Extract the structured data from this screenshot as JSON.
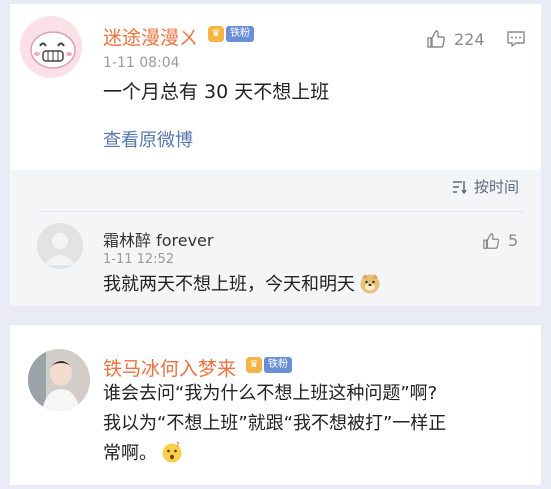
{
  "post": {
    "author": "迷途漫漫ㄨ",
    "badge": "铁粉",
    "time": "1-11 08:04",
    "text": "一个月总有 30 天不想上班",
    "view_original": "查看原微博",
    "likes": "224"
  },
  "sort_label": "按时间",
  "reply": {
    "author": "霜林醉 forever",
    "time": "1-11 12:52",
    "text": "我就两天不想上班，今天和明天",
    "likes": "5"
  },
  "post2": {
    "author": "铁马冰何入梦来",
    "badge": "铁粉",
    "line1": "谁会去问“我为什么不想上班这种问题”啊?",
    "line2": "我以为“不想上班”就跟“我不想被打”一样正",
    "line3": "常啊。"
  },
  "colors": {
    "author_name": "#eb7340",
    "link": "#5a78b0",
    "badge_tag": "#6b8fd6"
  }
}
